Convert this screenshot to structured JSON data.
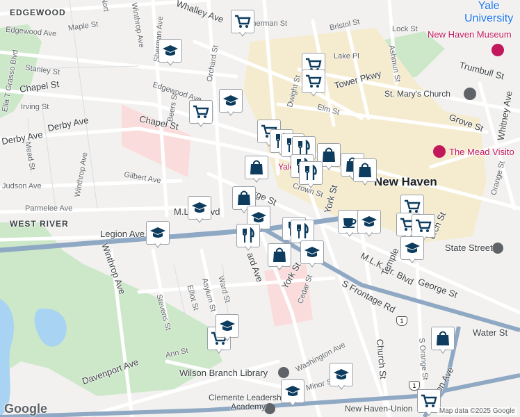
{
  "map": {
    "attribution": "Map data ©2025 Google",
    "logo": "Google",
    "colors": {
      "background": "#f2f1ef",
      "park": "#cde8c9",
      "water": "#a9d3f2",
      "campus": "#f5ecd0",
      "hospital": "#fbdcdc",
      "highway": "#8fa8c4",
      "marker_icon": "#0d3c5e"
    }
  },
  "labels": {
    "neighborhoods": {
      "edgewood": "EDGEWOOD",
      "west_river": "WEST RIVER"
    },
    "city": "New Haven",
    "pois": {
      "yale": "Yale\nUniversity",
      "museum": "New Haven Museum",
      "st_marys": "St. Mary's Church",
      "mead": "The Mead Visito",
      "yale_gallery": "Yale ... ery",
      "state_street": "State Street",
      "wilson_library": "Wilson Branch Library",
      "clemente": "Clemente Leadership\nAcademy",
      "union": "New Haven-Union"
    },
    "streets": {
      "maple": "Maple St",
      "winthrop_top": "Winthrop Ave",
      "sherman": "Sherman Ave",
      "whalley": "Whalley Ave",
      "sherman_st": "Sherman St",
      "bristol": "Bristol St",
      "lock": "Lock St",
      "norton": "Nort",
      "edgewood_ave": "Edgewood Ave",
      "ella_grasso": "Ella T Grasso Blvd",
      "stanley": "Stanley St",
      "chapel_left": "Chapel St",
      "irving": "Irving St",
      "orchard": "Orchard St",
      "lake": "Lake Pl",
      "tower": "Tower Pkwy",
      "ashmun": "Ashmun St",
      "trumbull": "Trumbull St",
      "edgewood_mid": "Edgewood Ave",
      "beers": "Beers St",
      "dwight": "Dwight St",
      "elm": "Elm St",
      "grove": "Grove St",
      "whitney": "Whitney Ave",
      "derby1": "Derby Ave",
      "derby2": "Derby Ave",
      "chapel_mid": "Chapel St",
      "mead_st": "Mead St",
      "winthrop_mid": "Winthrop Ave",
      "gilbert": "Gilbert Ave",
      "judson": "Judson Ave",
      "crown": "Crown St",
      "york": "York St",
      "george_top": "rge St",
      "parmelee": "Parmelee Ave",
      "mlk": "M.L.K. Blvd",
      "legion": "Legion Ave",
      "orange": "Orange St",
      "winthrop_low": "Winthrop Ave",
      "asylum": "Asylum St",
      "ward": "Ward St",
      "elliot": "Elliot St",
      "stevens": "Stevens St",
      "howard": "ard Ave",
      "york_low": "York St",
      "cedar": "Cedar St",
      "mlk_jr": "M.L.K. Jr. Blvd",
      "temple": "Temple",
      "george_low": "George St",
      "s_frontage": "S Frontage Rd",
      "church_ave": "urch St",
      "water": "Water St",
      "church_st": "Church St",
      "s_orange": "S Orange St",
      "ann": "Ann St",
      "davenport": "Davenport Ave",
      "washington": "Washington Ave",
      "minor": "Minor S",
      "union_ave": "Union Ave",
      "route_shield": "1",
      "route_shield2": "1",
      "lm": "L",
      "ml": "M.L"
    }
  },
  "markers": [
    {
      "type": "shopping-cart"
    },
    {
      "type": "school"
    },
    {
      "type": "shopping-cart"
    },
    {
      "type": "shopping-cart"
    },
    {
      "type": "school"
    },
    {
      "type": "shopping-cart"
    },
    {
      "type": "shopping-cart"
    },
    {
      "type": "restaurant"
    },
    {
      "type": "restaurant"
    },
    {
      "type": "restaurant"
    },
    {
      "type": "shopping-bag"
    },
    {
      "type": "shopping-bag"
    },
    {
      "type": "shopping-bag"
    },
    {
      "type": "restaurant"
    },
    {
      "type": "restaurant"
    },
    {
      "type": "shopping-bag"
    },
    {
      "type": "shopping-bag"
    },
    {
      "type": "school"
    },
    {
      "type": "school"
    },
    {
      "type": "school"
    },
    {
      "type": "restaurant"
    },
    {
      "type": "restaurant"
    },
    {
      "type": "shopping-bag"
    },
    {
      "type": "school"
    },
    {
      "type": "cafe"
    },
    {
      "type": "school"
    },
    {
      "type": "shopping-cart"
    },
    {
      "type": "shopping-cart"
    },
    {
      "type": "shopping-cart"
    },
    {
      "type": "school"
    },
    {
      "type": "school"
    },
    {
      "type": "shopping-cart"
    },
    {
      "type": "school"
    },
    {
      "type": "school"
    },
    {
      "type": "restaurant"
    },
    {
      "type": "shopping-bag"
    },
    {
      "type": "shopping-cart"
    }
  ]
}
